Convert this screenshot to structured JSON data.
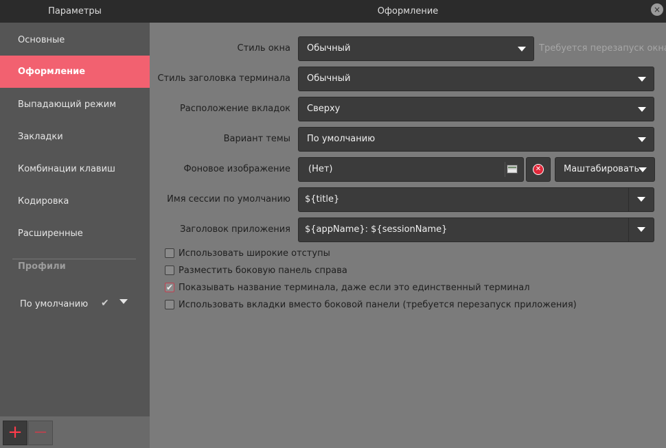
{
  "window": {
    "sidebar_title": "Параметры",
    "main_title": "Оформление",
    "close_glyph": "×"
  },
  "sidebar": {
    "items": [
      {
        "label": "Основные",
        "active": false
      },
      {
        "label": "Оформление",
        "active": true
      },
      {
        "label": "Выпадающий режим",
        "active": false
      },
      {
        "label": "Закладки",
        "active": false
      },
      {
        "label": "Комбинации клавиш",
        "active": false
      },
      {
        "label": "Кодировка",
        "active": false
      },
      {
        "label": "Расширенные",
        "active": false
      }
    ],
    "profiles_header": "Профили",
    "profiles": [
      {
        "name": "По умолчанию",
        "selected": true
      }
    ],
    "add_glyph": "+",
    "remove_glyph": "−"
  },
  "form": {
    "window_style": {
      "label": "Стиль окна",
      "value": "Обычный",
      "hint": "Требуется перезапуск окна"
    },
    "terminal_title_style": {
      "label": "Стиль заголовка терминала",
      "value": "Обычный"
    },
    "tab_position": {
      "label": "Расположение вкладок",
      "value": "Сверху"
    },
    "theme_variant": {
      "label": "Вариант темы",
      "value": "По умолчанию"
    },
    "background_image": {
      "label": "Фоновое изображение",
      "value": "(Нет)",
      "scale_mode": "Маштабировать"
    },
    "default_session_name": {
      "label": "Имя сессии по умолчанию",
      "value": "${title}"
    },
    "app_title": {
      "label": "Заголовок приложения",
      "value": "${appName}: ${sessionName}"
    }
  },
  "checkboxes": [
    {
      "label": "Использовать широкие отступы",
      "checked": false
    },
    {
      "label": "Разместить боковую панель справа",
      "checked": false
    },
    {
      "label": "Показывать название терминала, даже если это единственный терминал",
      "checked": true
    },
    {
      "label": "Использовать вкладки вместо боковой панели (требуется перезапуск приложения)",
      "checked": false
    }
  ],
  "colors": {
    "accent": "#f26170",
    "titlebar": "#2b2b2b",
    "sidebar": "#555555",
    "content": "#7b7b7b",
    "widget": "#3b3b3b"
  },
  "icons": {
    "close": "close-icon",
    "check": "check-icon",
    "dropdown": "chevron-down-icon",
    "folder": "folder-icon",
    "clear": "clear-icon",
    "add": "plus-icon",
    "remove": "minus-icon"
  }
}
